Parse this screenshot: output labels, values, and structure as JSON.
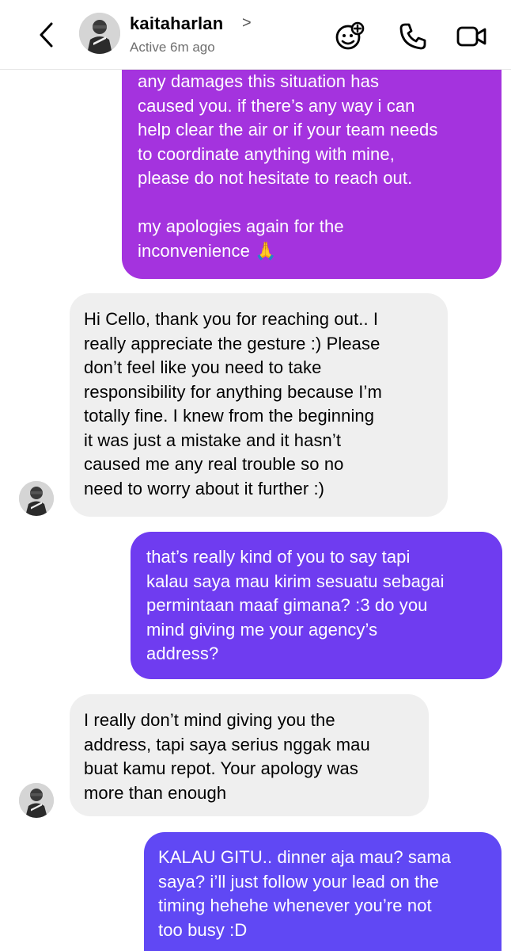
{
  "header": {
    "username": "kaitaharlan",
    "username_chevron": ">",
    "status": "Active 6m ago"
  },
  "icons": {
    "back": "chevron-left-icon",
    "add_effects": "sticker-plus-icon",
    "call": "phone-icon",
    "video": "video-camera-icon"
  },
  "colors": {
    "outgoing_purple": "#a433de",
    "outgoing_violet": "#6f3cf0",
    "outgoing_indigo": "#6048f4",
    "incoming_gray": "#efefef"
  },
  "messages": [
    {
      "from": "me",
      "text": "any damages this situation has\ncaused you. if there’s any way i can\nhelp clear the air or if your team needs\nto coordinate anything with mine,\nplease do not hesitate to reach out.\n\nmy apologies again for the\ninconvenience 🙏"
    },
    {
      "from": "them",
      "text": "Hi Cello, thank you for reaching out.. I\nreally appreciate the gesture :) Please\ndon’t feel like you need to take\nresponsibility for anything because I’m\ntotally fine. I knew from the beginning\nit was just a mistake and it hasn’t\ncaused me any real trouble so no\nneed to worry about it further :)"
    },
    {
      "from": "me",
      "text": "that’s really kind of you to say tapi\nkalau saya mau kirim sesuatu sebagai\npermintaan maaf gimana? :3 do you\nmind giving me your agency’s\naddress?"
    },
    {
      "from": "them",
      "text": "I really don’t mind giving you the\naddress, tapi saya serius nggak mau\nbuat kamu repot. Your apology was\nmore than enough"
    },
    {
      "from": "me",
      "text": "KALAU GITU.. dinner aja mau? sama\nsaya? i’ll just follow your lead on the\ntiming hehehe whenever you’re not\ntoo busy :D"
    }
  ]
}
